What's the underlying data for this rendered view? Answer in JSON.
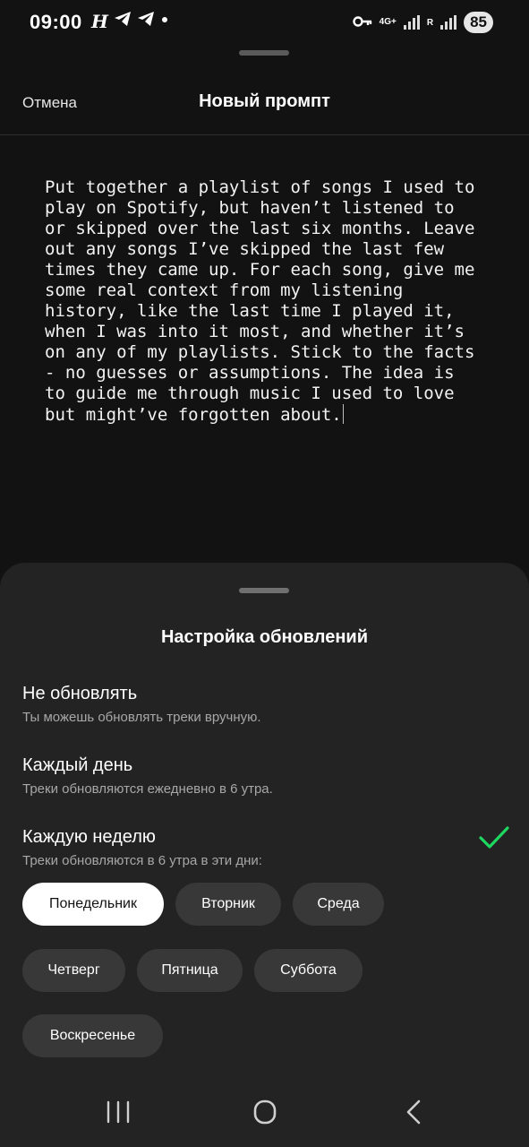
{
  "status_bar": {
    "time": "09:00",
    "app_icons": [
      "𝓗",
      "telegram-icon",
      "telegram-icon",
      "dot"
    ],
    "network": "4G+",
    "roaming": "R",
    "battery": "85"
  },
  "header": {
    "cancel_label": "Отмена",
    "title": "Новый промпт"
  },
  "prompt": {
    "text": "Put together a playlist of songs I used to\nplay on Spotify, but haven’t listened to\nor skipped over the last six months. Leave\nout any songs I’ve skipped the last few\ntimes they came up. For each song, give me\nsome real context from my listening\nhistory, like the last time I played it,\nwhen I was into it most, and whether it’s\non any of my playlists. Stick to the facts\n- no guesses or assumptions. The idea is\nto guide me through music I used to love\nbut might’ve forgotten about."
  },
  "sheet": {
    "title": "Настройка обновлений",
    "options": [
      {
        "title": "Не обновлять",
        "subtitle": "Ты можешь обновлять треки вручную.",
        "selected": false
      },
      {
        "title": "Каждый день",
        "subtitle": "Треки обновляются ежедневно в 6 утра.",
        "selected": false
      },
      {
        "title": "Каждую неделю",
        "subtitle": "Треки обновляются в 6 утра в эти дни:",
        "selected": true
      }
    ],
    "days": [
      {
        "label": "Понедельник",
        "selected": true
      },
      {
        "label": "Вторник",
        "selected": false
      },
      {
        "label": "Среда",
        "selected": false
      },
      {
        "label": "Четверг",
        "selected": false
      },
      {
        "label": "Пятница",
        "selected": false
      },
      {
        "label": "Суббота",
        "selected": false
      },
      {
        "label": "Воскресенье",
        "selected": false
      }
    ],
    "accent_color": "#1ed760"
  },
  "nav_bar": {
    "buttons": [
      "recents-icon",
      "home-icon",
      "back-icon"
    ]
  }
}
